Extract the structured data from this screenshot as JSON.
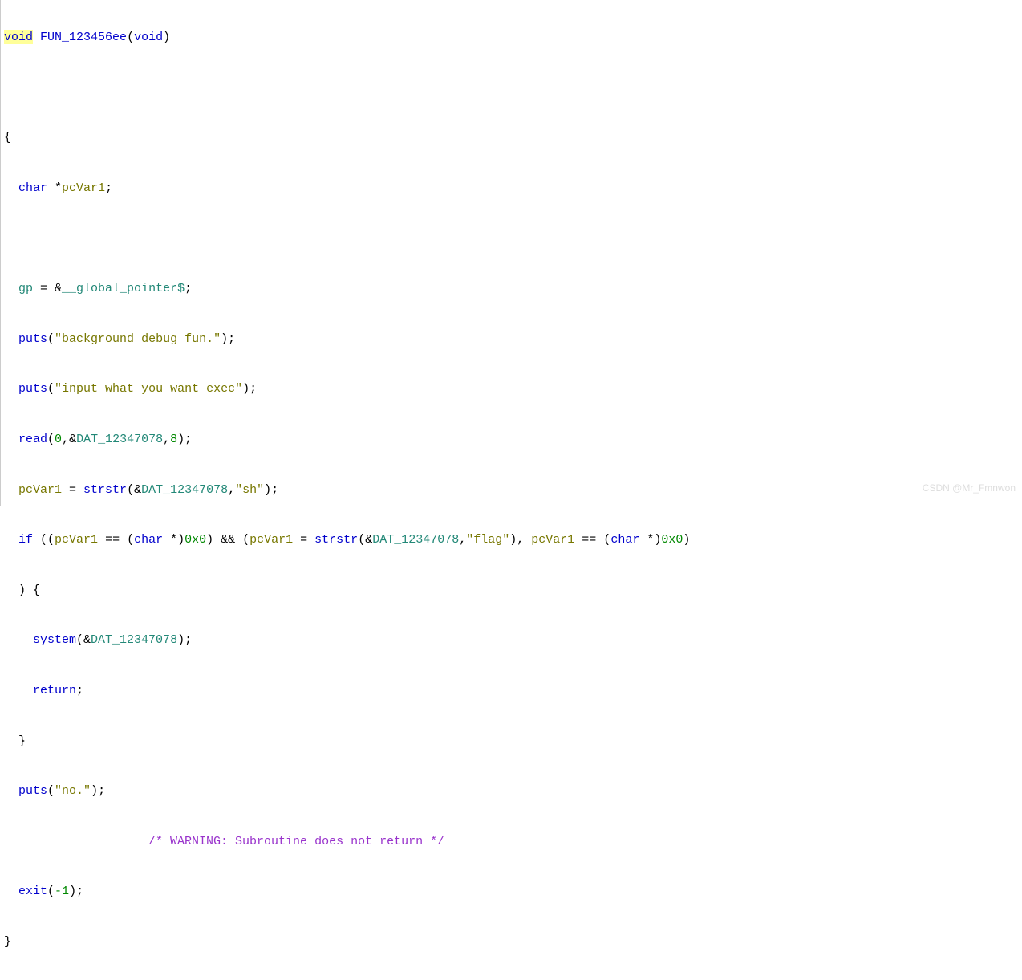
{
  "sig": {
    "void1": "void",
    "funcName": "FUN_123456ee",
    "void2": "void"
  },
  "decl": {
    "charStar": "char",
    "star": " *",
    "pcVar1": "pcVar1"
  },
  "gpAssign": {
    "gp": "gp",
    "eq": " = &",
    "global_ptr": "__global_pointer$"
  },
  "puts1": {
    "call": "puts",
    "str": "\"background debug fun.\""
  },
  "puts2": {
    "call": "puts",
    "str": "\"input what you want exec\""
  },
  "read": {
    "call": "read",
    "zero": "0",
    "dat": "DAT_12347078",
    "eight": "8"
  },
  "strstr1": {
    "pcVar1": "pcVar1",
    "call": "strstr",
    "dat": "DAT_12347078",
    "str": "\"sh\""
  },
  "ifline": {
    "ifkw": "if",
    "pcVar1a": "pcVar1",
    "charType": "char",
    "null1": "0x0",
    "pcVar1b": "pcVar1",
    "call": "strstr",
    "dat": "DAT_12347078",
    "flagStr": "\"flag\"",
    "pcVar1c": "pcVar1",
    "charType2": "char",
    "null2": "0x0"
  },
  "system": {
    "call": "system",
    "dat": "DAT_12347078"
  },
  "returnKw": "return",
  "putsNo": {
    "call": "puts",
    "str": "\"no.\""
  },
  "comment": "/* WARNING: Subroutine does not return */",
  "exit": {
    "call": "exit",
    "neg1": "-1"
  },
  "watermark": "CSDN @Mr_Fmnwon"
}
